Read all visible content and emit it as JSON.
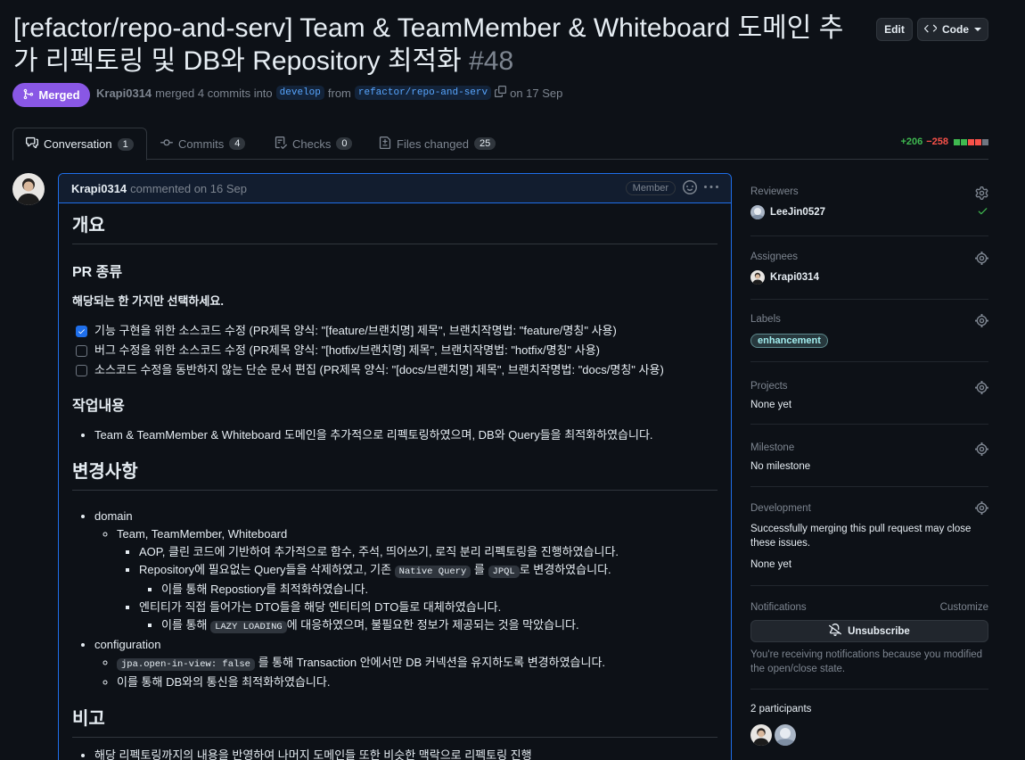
{
  "header": {
    "title": "[refactor/repo-and-serv] Team & TeamMember & Whiteboard 도메인 추가 리펙토링 및 DB와 Repository 최적화",
    "number": "#48",
    "edit_label": "Edit",
    "code_label": "Code"
  },
  "status": {
    "badge": "Merged",
    "author": "Krapi0314",
    "merged_text": "merged 4 commits into",
    "base_branch": "develop",
    "from_text": "from",
    "head_branch": "refactor/repo-and-serv",
    "date_text": "on 17 Sep"
  },
  "tabs": [
    {
      "label": "Conversation",
      "count": "1"
    },
    {
      "label": "Commits",
      "count": "4"
    },
    {
      "label": "Checks",
      "count": "0"
    },
    {
      "label": "Files changed",
      "count": "25"
    }
  ],
  "diffstat": {
    "additions": "+206",
    "deletions": "−258",
    "blocks": [
      "#3fb950",
      "#3fb950",
      "#f85149",
      "#f85149",
      "#6e7681"
    ]
  },
  "comment": {
    "author": "Krapi0314",
    "action": "commented on 16 Sep",
    "role": "Member",
    "h_overview": "개요",
    "h_pr_type": "PR 종류",
    "pr_type_instruction": "해당되는 한 가지만 선택하세요.",
    "checkboxes": [
      {
        "label": "기능 구현을 위한 소스코드 수정 (PR제목 양식: \"[feature/브랜치명] 제목\", 브랜치작명법: \"feature/명칭\" 사용)",
        "checked": true
      },
      {
        "label": "버그 수정을 위한 소스코드 수정 (PR제목 양식: \"[hotfix/브랜치명] 제목\", 브랜치작명법: \"hotfix/명칭\" 사용)",
        "checked": false
      },
      {
        "label": "소스코드 수정을 동반하지 않는 단순 문서 편집 (PR제목 양식: \"[docs/브랜치명] 제목\", 브랜치작명법: \"docs/명칭\" 사용)",
        "checked": false
      }
    ],
    "h_work": "작업내용",
    "work_item": "Team & TeamMember & Whiteboard 도메인을 추가적으로 리펙토링하였으며, DB와 Query들을 최적화하였습니다.",
    "h_changes": "변경사항",
    "changes": {
      "domain": "domain",
      "domain_entities": "Team, TeamMember, Whiteboard",
      "aop": "AOP, 클린 코드에 기반하여 추가적으로 함수, 주석, 띄어쓰기, 로직 분리 리펙토링을 진행하였습니다.",
      "repo_pre": "Repository에 필요없는 Query들을 삭제하였고, 기존",
      "repo_code1": "Native Query",
      "repo_mid": "를",
      "repo_code2": "JPQL",
      "repo_post": "로 변경하였습니다.",
      "repo_sub": "이를 통해 Repostiory를 최적화하였습니다.",
      "dto": "엔티티가 직접 들어가는 DTO들을 해당 엔티티의 DTO들로 대체하였습니다.",
      "dto_sub_pre": "이를 통해",
      "dto_sub_code": "LAZY LOADING",
      "dto_sub_post": "에 대응하였으며, 불필요한 정보가 제공되는 것을 막았습니다.",
      "configuration": "configuration",
      "conf_code": "jpa.open-in-view: false",
      "conf_post": "를 통해 Transaction 안에서만 DB 커넥션을 유지하도록 변경하였습니다.",
      "conf_db": "이를 통해 DB와의 통신을 최적화하였습니다."
    },
    "h_note": "비고",
    "note_item": "해당 리펙토링까지의 내용을 반영하여 나머지 도메인들 또한 비슷한 맥락으로 리펙토링 진행"
  },
  "sidebar": {
    "reviewers_title": "Reviewers",
    "reviewer": "LeeJin0527",
    "assignees_title": "Assignees",
    "assignee": "Krapi0314",
    "labels_title": "Labels",
    "label": "enhancement",
    "projects_title": "Projects",
    "projects_value": "None yet",
    "milestone_title": "Milestone",
    "milestone_value": "No milestone",
    "development_title": "Development",
    "development_text": "Successfully merging this pull request may close these issues.",
    "development_value": "None yet",
    "notifications_title": "Notifications",
    "customize_label": "Customize",
    "unsubscribe_label": "Unsubscribe",
    "notifications_text": "You're receiving notifications because you modified the open/close state.",
    "participants_title": "2 participants"
  }
}
